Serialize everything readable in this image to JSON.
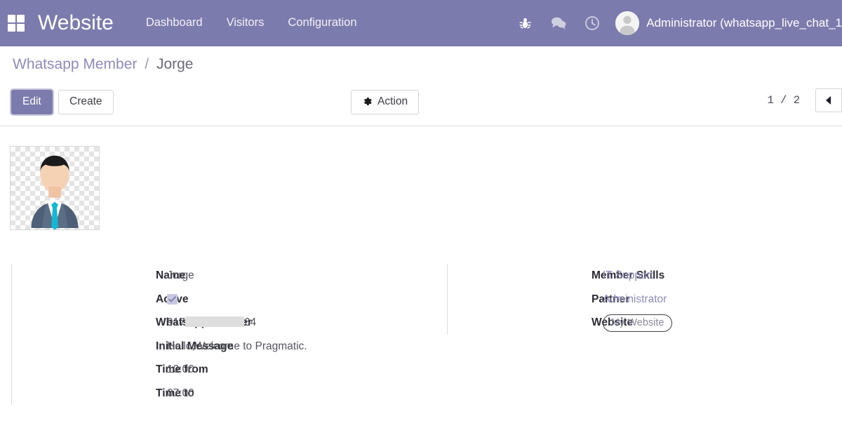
{
  "navbar": {
    "apps_icon": "apps-grid-icon",
    "brand": "Website",
    "menu": [
      {
        "label": "Dashboard"
      },
      {
        "label": "Visitors"
      },
      {
        "label": "Configuration"
      }
    ],
    "icons": [
      {
        "name": "bug-icon"
      },
      {
        "name": "messages-icon"
      },
      {
        "name": "clock-icon"
      }
    ],
    "user": "Administrator (whatsapp_live_chat_1",
    "background_color": "#7c7bad"
  },
  "breadcrumb": {
    "parent": "Whatsapp Member",
    "separator": "/",
    "current": "Jorge"
  },
  "control_panel": {
    "edit_label": "Edit",
    "create_label": "Create",
    "action_label": "Action",
    "action_icon": "gear-icon",
    "pager_count": "1 / 2",
    "pager_prev_icon": "caret-left-icon"
  },
  "form": {
    "avatar_alt": "member-avatar-placeholder",
    "left_fields": [
      {
        "label": "Name",
        "value": "Jorge",
        "type": "text"
      },
      {
        "label": "Active",
        "value": "",
        "type": "checkbox"
      },
      {
        "label": "Whatsapp Number",
        "value": "917",
        "value_suffix": "64",
        "type": "redacted"
      },
      {
        "label": "Initial Message",
        "value": "Hello,Welcome to Pragmatic.",
        "type": "text"
      },
      {
        "label": "Time from",
        "value": "10:00",
        "type": "text"
      },
      {
        "label": "Time to",
        "value": "07:00",
        "type": "text"
      }
    ],
    "right_fields": [
      {
        "label": "Member Skills",
        "value": "IT Support",
        "type": "link"
      },
      {
        "label": "Partner",
        "value": "Administrator",
        "type": "link"
      },
      {
        "label": "Website",
        "value": "My Website",
        "type": "badge"
      }
    ]
  },
  "colors": {
    "brand_purple": "#7c7bad",
    "link_purple": "#8d8bbd",
    "label_dark": "#2b2b33",
    "value_gray": "#555560"
  }
}
